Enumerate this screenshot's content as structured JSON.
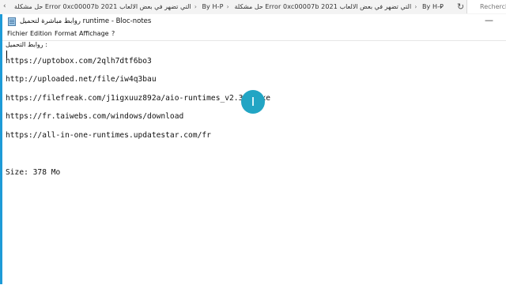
{
  "browser_bar": {
    "breadcrumbs": [
      "حل مشكلة Error 0xc00007b 2021 التي تضهر في بعض الالعاب",
      "By H-P",
      "حل مشكلة Error 0xc00007b 2021 التي تضهر في بعض الالعاب",
      "By H-P"
    ],
    "search_placeholder": "Recherche"
  },
  "window": {
    "title": "روابط مباشرة لتحميل runtime - Bloc-notes",
    "minimize_glyph": "—"
  },
  "menu": {
    "items": [
      "Fichier",
      "Edition",
      "Format",
      "Affichage",
      "?"
    ]
  },
  "document": {
    "lines": [
      "روابط التحميل :",
      "https://uptobox.com/2qlh7dtf6bo3",
      "http://uploaded.net/file/iw4q3bau",
      "https://filefreak.com/j1igxuuz892a/aio-runtimes_v2.3.1.exe",
      "https://fr.taiwebs.com/windows/download",
      "https://all-in-one-runtimes.updatestar.com/fr",
      "Size: 378 Mo"
    ]
  },
  "colors": {
    "cursor_highlight": "#22a5c4",
    "window_edge": "#1e9bd7"
  }
}
